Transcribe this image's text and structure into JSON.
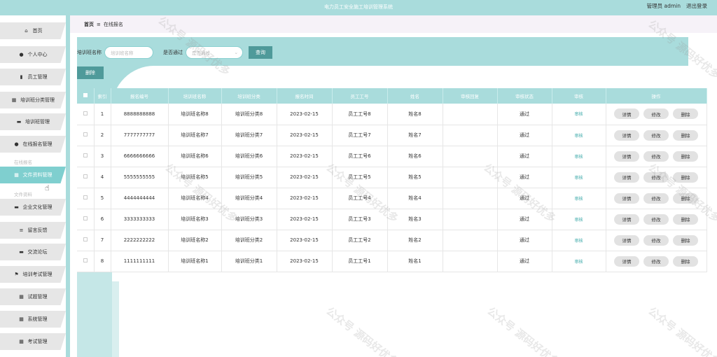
{
  "header": {
    "app_title": "电力员工安全施工培训管理系统",
    "user_label": "管理员 admin",
    "logout_label": "退出登录"
  },
  "sidebar": {
    "items": [
      {
        "label": "首页",
        "icon": "home-icon",
        "glyph": "⌂"
      },
      {
        "label": "个人中心",
        "icon": "user-icon",
        "glyph": "●"
      },
      {
        "label": "员工管理",
        "icon": "bar-chart-icon",
        "glyph": "▮"
      },
      {
        "label": "培训班分类管理",
        "icon": "grid-icon",
        "glyph": "▦"
      },
      {
        "label": "培训班管理",
        "icon": "monitor-icon",
        "glyph": "▬"
      },
      {
        "label": "在线报名管理",
        "icon": "user-icon",
        "glyph": "●"
      },
      {
        "label": "文件资料管理",
        "icon": "grid-icon",
        "glyph": "▦"
      },
      {
        "label": "企业文化管理",
        "icon": "monitor-icon",
        "glyph": "▬"
      },
      {
        "label": "留言反馈",
        "icon": "list-icon",
        "glyph": "≡"
      },
      {
        "label": "交流论坛",
        "icon": "bubble-icon",
        "glyph": "▬"
      },
      {
        "label": "培训考试管理",
        "icon": "flag-icon",
        "glyph": "⚑"
      },
      {
        "label": "试题管理",
        "icon": "grid-icon",
        "glyph": "▦"
      },
      {
        "label": "系统管理",
        "icon": "grid-icon",
        "glyph": "▦"
      },
      {
        "label": "考试管理",
        "icon": "grid-icon",
        "glyph": "▦"
      }
    ],
    "submenu_1": "在线报名",
    "submenu_2": "文件资料"
  },
  "breadcrumb": {
    "home": "首页",
    "separator": "≡",
    "current": "在线报名"
  },
  "search": {
    "name_label": "培训班名称",
    "name_placeholder": "培训班名称",
    "status_label": "是否通过",
    "status_placeholder": "是否通过",
    "query_button": "查询"
  },
  "toolbar": {
    "delete_button": "删除"
  },
  "table": {
    "columns": [
      "",
      "索引",
      "报名编号",
      "培训班名称",
      "培训班分类",
      "报名时间",
      "员工工号",
      "姓名",
      "审核回复",
      "审核状态",
      "审核",
      "操作"
    ],
    "review_label": "审核",
    "actions": {
      "detail": "详情",
      "edit": "修改",
      "delete": "删除"
    },
    "rows": [
      {
        "index": "1",
        "reg_no": "8888888888",
        "class_name": "培训班名称8",
        "category": "培训班分类8",
        "date": "2023-02-15",
        "emp_no": "员工工号8",
        "name": "姓名8",
        "reply": "",
        "status": "通过"
      },
      {
        "index": "2",
        "reg_no": "7777777777",
        "class_name": "培训班名称7",
        "category": "培训班分类7",
        "date": "2023-02-15",
        "emp_no": "员工工号7",
        "name": "姓名7",
        "reply": "",
        "status": "通过"
      },
      {
        "index": "3",
        "reg_no": "6666666666",
        "class_name": "培训班名称6",
        "category": "培训班分类6",
        "date": "2023-02-15",
        "emp_no": "员工工号6",
        "name": "姓名6",
        "reply": "",
        "status": "通过"
      },
      {
        "index": "4",
        "reg_no": "5555555555",
        "class_name": "培训班名称5",
        "category": "培训班分类5",
        "date": "2023-02-15",
        "emp_no": "员工工号5",
        "name": "姓名5",
        "reply": "",
        "status": "通过"
      },
      {
        "index": "5",
        "reg_no": "4444444444",
        "class_name": "培训班名称4",
        "category": "培训班分类4",
        "date": "2023-02-15",
        "emp_no": "员工工号4",
        "name": "姓名4",
        "reply": "",
        "status": "通过"
      },
      {
        "index": "6",
        "reg_no": "3333333333",
        "class_name": "培训班名称3",
        "category": "培训班分类3",
        "date": "2023-02-15",
        "emp_no": "员工工号3",
        "name": "姓名3",
        "reply": "",
        "status": "通过"
      },
      {
        "index": "7",
        "reg_no": "2222222222",
        "class_name": "培训班名称2",
        "category": "培训班分类2",
        "date": "2023-02-15",
        "emp_no": "员工工号2",
        "name": "姓名2",
        "reply": "",
        "status": "通过"
      },
      {
        "index": "8",
        "reg_no": "1111111111",
        "class_name": "培训班名称1",
        "category": "培训班分类1",
        "date": "2023-02-15",
        "emp_no": "员工工号1",
        "name": "姓名1",
        "reply": "",
        "status": "通过"
      }
    ]
  },
  "watermark": "公众号 源码好优多",
  "colors": {
    "accent": "#a9dcdc",
    "button": "#4f9a9a",
    "active_menu": "#7fcfcf"
  }
}
